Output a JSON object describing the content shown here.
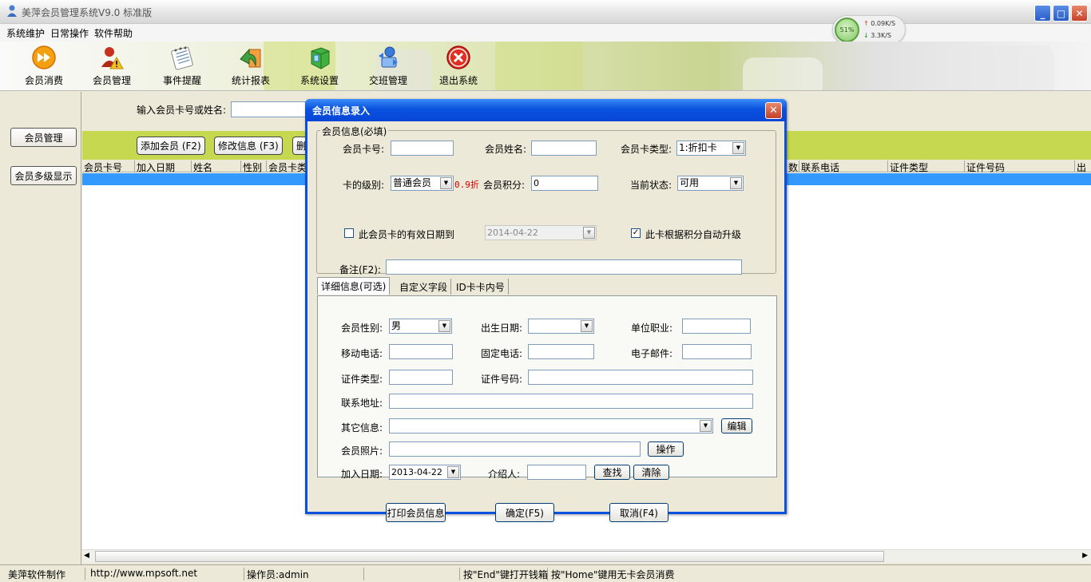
{
  "window": {
    "title": "美萍会员管理系统V9.0 标准版",
    "min": "_",
    "max": "□",
    "close": "✕"
  },
  "menu": [
    "系统维护",
    "日常操作",
    "软件帮助"
  ],
  "netwidget": {
    "cpu": "51%",
    "up": "0.09K/S",
    "down": "3.3K/S"
  },
  "toolbar": [
    {
      "label": "会员消费",
      "icon": "fast-forward-icon"
    },
    {
      "label": "会员管理",
      "icon": "users-warning-icon"
    },
    {
      "label": "事件提醒",
      "icon": "notepad-icon"
    },
    {
      "label": "统计报表",
      "icon": "chart-arrow-icon"
    },
    {
      "label": "系统设置",
      "icon": "settings-cube-icon"
    },
    {
      "label": "交班管理",
      "icon": "handover-icon"
    },
    {
      "label": "退出系统",
      "icon": "exit-icon"
    }
  ],
  "left": {
    "btn1": "会员管理",
    "btn2": "会员多级显示"
  },
  "search": {
    "label": "输入会员卡号或姓名:"
  },
  "actions": {
    "add": "添加会员 (F2)",
    "edit": "修改信息 (F3)",
    "del": "删"
  },
  "grid": {
    "columns": [
      "会员卡号",
      "加入日期",
      "姓名",
      "性别",
      "会员卡类",
      "数",
      "联系电话",
      "证件类型",
      "证件号码",
      "出"
    ]
  },
  "status": [
    "美萍软件制作",
    "http://www.mpsoft.net",
    "操作员:admin",
    "",
    "按\"End\"键打开钱箱",
    "按\"Home\"键用无卡会员消费"
  ],
  "dialog": {
    "title": "会员信息录入",
    "group_required": "会员信息(必填)",
    "card_no_label": "会员卡号:",
    "card_no": "",
    "name_label": "会员姓名:",
    "name": "",
    "card_type_label": "会员卡类型:",
    "card_type": "1:折扣卡",
    "level_label": "卡的级别:",
    "level": "普通会员",
    "discount": "0.9折",
    "points_label": "会员积分:",
    "points": "0",
    "state_label": "当前状态:",
    "state": "可用",
    "expire_check_label": "此会员卡的有效日期到",
    "expire_date": "2014-04-22",
    "auto_upgrade_label": "此卡根据积分自动升级",
    "remark_label": "备注(F2):",
    "tabs": [
      "详细信息(可选)",
      "自定义字段",
      "ID卡卡内号"
    ],
    "gender_label": "会员性别:",
    "gender": "男",
    "birthday_label": "出生日期:",
    "job_label": "单位职业:",
    "mobile_label": "移动电话:",
    "phone_label": "固定电话:",
    "email_label": "电子邮件:",
    "idtype_label": "证件类型:",
    "idno_label": "证件号码:",
    "address_label": "联系地址:",
    "other_label": "其它信息:",
    "edit_btn": "编辑",
    "photo_label": "会员照片:",
    "op_btn": "操作",
    "join_label": "加入日期:",
    "join_date": "2013-04-22",
    "referrer_label": "介绍人:",
    "find_btn": "查找",
    "clear_btn": "清除",
    "print_btn": "打印会员信息",
    "ok_btn": "确定(F5)",
    "cancel_btn": "取消(F4)"
  }
}
